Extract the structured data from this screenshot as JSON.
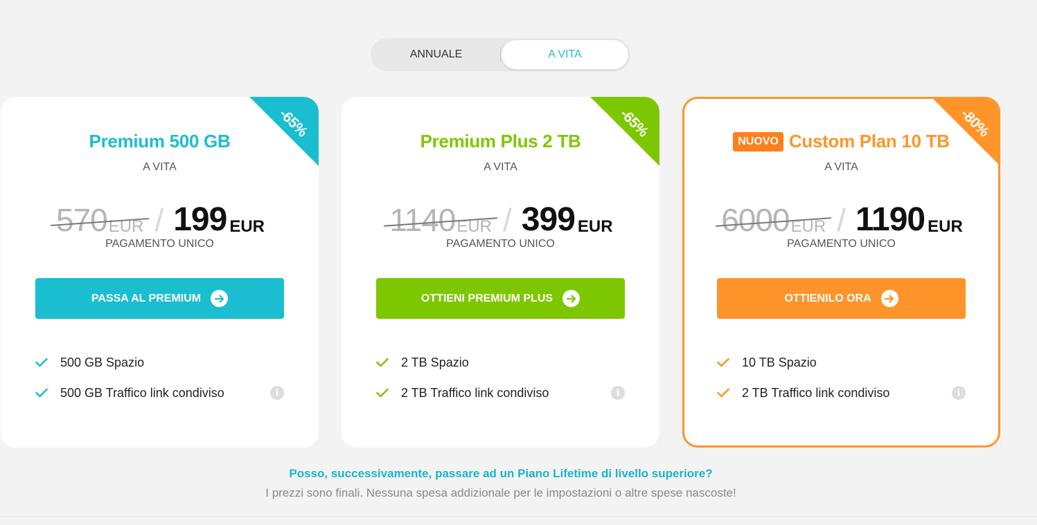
{
  "toggle": {
    "annual_label": "ANNUALE",
    "lifetime_label": "A VITA",
    "selected": "lifetime"
  },
  "plans": [
    {
      "discount": "-65%",
      "title": "Premium 500 GB",
      "period": "A VITA",
      "old_price": "570",
      "old_currency": "EUR",
      "new_price": "199",
      "new_currency": "EUR",
      "payment": "PAGAMENTO UNICO",
      "button_label": "PASSA AL PREMIUM",
      "features": [
        "500 GB Spazio",
        "500 GB Traffico link condiviso"
      ],
      "color": "#1bbdd0"
    },
    {
      "discount": "-65%",
      "title": "Premium Plus 2 TB",
      "period": "A VITA",
      "old_price": "1140",
      "old_currency": "EUR",
      "new_price": "399",
      "new_currency": "EUR",
      "payment": "PAGAMENTO UNICO",
      "button_label": "OTTIENI PREMIUM PLUS",
      "features": [
        "2 TB Spazio",
        "2 TB Traffico link condiviso"
      ],
      "color": "#7dc700"
    },
    {
      "discount": "-80%",
      "badge": "NUOVO",
      "title": "Custom Plan 10 TB",
      "period": "A VITA",
      "old_price": "6000",
      "old_currency": "EUR",
      "new_price": "1190",
      "new_currency": "EUR",
      "payment": "PAGAMENTO UNICO",
      "button_label": "OTTIENILO ORA",
      "features": [
        "10 TB Spazio",
        "2 TB Traffico link condiviso"
      ],
      "color": "#ff952a"
    }
  ],
  "footer": {
    "faq": "Posso, successivamente, passare ad un Piano Lifetime di livello superiore?",
    "note": "I prezzi sono finali. Nessuna spesa addizionale per le impostazioni o altre spese nascoste!"
  },
  "icons": {
    "check": "check-icon",
    "arrow": "arrow-right-circle-icon",
    "info": "info-icon"
  }
}
